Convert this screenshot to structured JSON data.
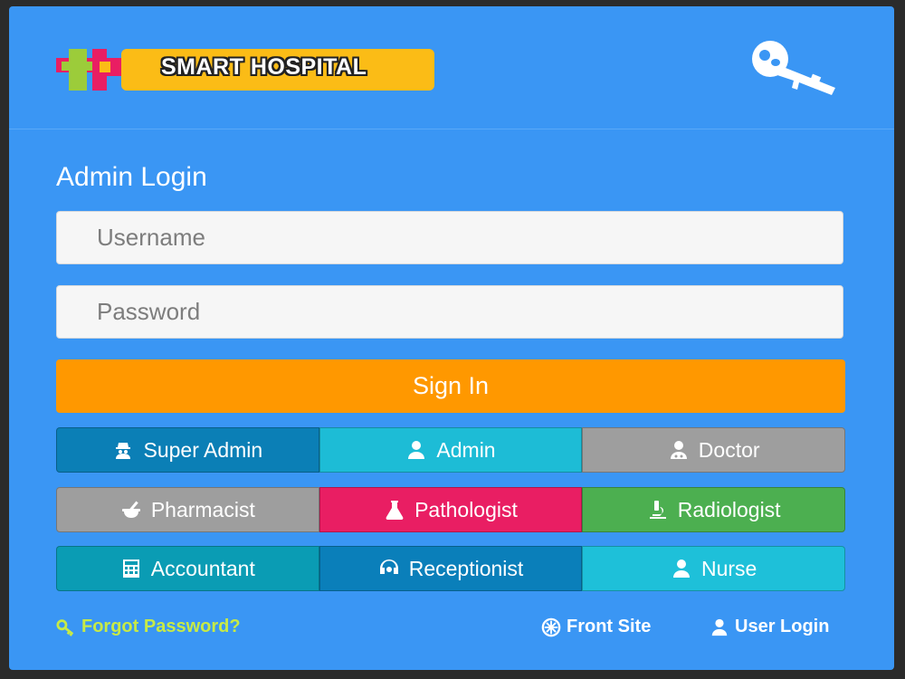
{
  "brand": {
    "name": "SMART HOSPITAL"
  },
  "login": {
    "title": "Admin Login",
    "username_placeholder": "Username",
    "password_placeholder": "Password",
    "signin_label": "Sign In"
  },
  "roles": [
    {
      "label": "Super Admin",
      "icon": "user-secret-icon",
      "color": "#0b7fb6"
    },
    {
      "label": "Admin",
      "icon": "user-icon",
      "color": "#1dbcd6"
    },
    {
      "label": "Doctor",
      "icon": "user-md-icon",
      "color": "#9e9e9e"
    },
    {
      "label": "Pharmacist",
      "icon": "mortar-pestle-icon",
      "color": "#9e9e9e"
    },
    {
      "label": "Pathologist",
      "icon": "flask-icon",
      "color": "#e91e63"
    },
    {
      "label": "Radiologist",
      "icon": "microscope-icon",
      "color": "#4caf50"
    },
    {
      "label": "Accountant",
      "icon": "calculator-icon",
      "color": "#0a9cb4"
    },
    {
      "label": "Receptionist",
      "icon": "headset-icon",
      "color": "#0a7fba"
    },
    {
      "label": "Nurse",
      "icon": "user-icon",
      "color": "#1ec0d9"
    }
  ],
  "footer": {
    "forgot_label": "Forgot Password?",
    "front_site_label": "Front Site",
    "user_login_label": "User Login"
  },
  "colors": {
    "panel": "#3a96f4",
    "signin": "#ff9800",
    "forgot_link": "#c7ea46",
    "logo_bar": "#fbbc16"
  }
}
